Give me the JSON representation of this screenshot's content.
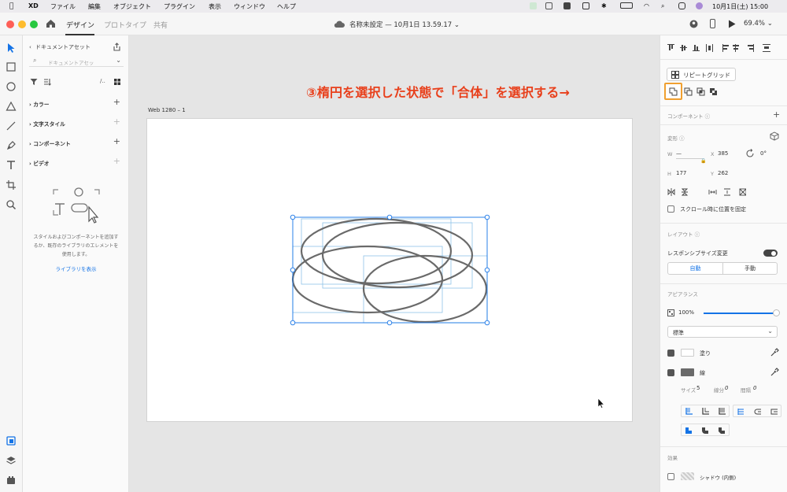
{
  "menubar": {
    "app": "XD",
    "items": [
      "ファイル",
      "編集",
      "オブジェクト",
      "プラグイン",
      "表示",
      "ウィンドウ",
      "ヘルプ"
    ],
    "clock": "10月1日(土) 15:00"
  },
  "titlebar": {
    "tabs": [
      "デザイン",
      "プロトタイプ",
      "共有"
    ],
    "doc_title": "名称未設定 — 10月1日 13.59.17",
    "zoom": "69.4%"
  },
  "assets": {
    "header": "ドキュメントアセット",
    "search_placeholder": "ドキュメントアセッ",
    "sections": [
      "カラー",
      "文字スタイル",
      "コンポーネント",
      "ビデオ"
    ],
    "empty_text_1": "スタイルおよびコンポーネントを追加す",
    "empty_text_2": "るか、既存のライブラリのエレメントを",
    "empty_text_3": "使用します。",
    "library_link": "ライブラリを表示"
  },
  "canvas": {
    "artboard_label": "Web 1280 – 1"
  },
  "annotation": "③楕円を選択した状態で「合体」を選択する→",
  "inspector": {
    "repeat_grid": "リピートグリッド",
    "component_label": "コンポーネント",
    "transform_label": "変形",
    "w_label": "W",
    "w_value": "—",
    "h_label": "H",
    "h_value": "177",
    "x_label": "X",
    "x_value": "385",
    "y_label": "Y",
    "y_value": "262",
    "rotation": "0°",
    "scroll_fix": "スクロール時に位置を固定",
    "layout_label": "レイアウト",
    "responsive_label": "レスポンシブサイズ変更",
    "auto": "自動",
    "manual": "手動",
    "appearance_label": "アピアランス",
    "opacity": "100%",
    "blend_mode": "標準",
    "fill_label": "塗り",
    "stroke_label": "線",
    "size_label": "サイズ",
    "size_value": "5",
    "dash_label": "線分",
    "dash_value": "0",
    "gap_label": "間隔",
    "gap_value": "0",
    "effects_label": "効果",
    "shadow_label": "シャドウ (内側)"
  },
  "colors": {
    "accent": "#1473e6",
    "annotation": "#e8401c",
    "highlight": "#f0a030",
    "stroke": "#6a6a6a"
  }
}
